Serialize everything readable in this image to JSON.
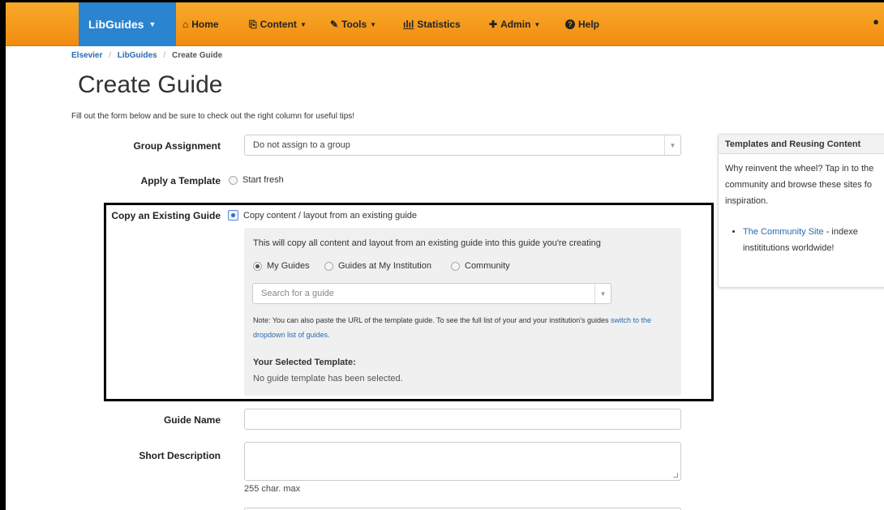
{
  "nav": {
    "brand": "LibGuides",
    "items": [
      {
        "label": "Home",
        "icon": "home-icon",
        "glyph": "🏠"
      },
      {
        "label": "Content",
        "icon": "content-icon",
        "glyph": "⎘"
      },
      {
        "label": "Tools",
        "icon": "wrench-icon",
        "glyph": "🔧"
      },
      {
        "label": "Statistics",
        "icon": "bar-chart-icon",
        "glyph": "▥"
      },
      {
        "label": "Admin",
        "icon": "puzzle-icon",
        "glyph": "⧉"
      },
      {
        "label": "Help",
        "icon": "help-icon",
        "glyph": "?"
      }
    ]
  },
  "breadcrumb": [
    "Elsevier",
    "LibGuides",
    "Create Guide"
  ],
  "page": {
    "title": "Create Guide",
    "intro": "Fill out the form below and be sure to check out the right column for useful tips!"
  },
  "form": {
    "group_label": "Group Assignment",
    "group_value": "Do not assign to a group",
    "template_label": "Apply a Template",
    "template_option": "Start fresh",
    "copy_label": "Copy an Existing Guide",
    "copy_option": "Copy content / layout from an existing guide",
    "copy_desc": "This will copy all content and layout from an existing guide into this guide you're creating",
    "scope_options": [
      "My Guides",
      "Guides at My Institution",
      "Community"
    ],
    "search_placeholder": "Search for a guide",
    "note_text": "Note: You can also paste the URL of the template guide. To see the full list of your and your institution's guides",
    "note_link": "switch to the dropdown list of guides.",
    "selected_title": "Your Selected Template:",
    "selected_none": "No guide template has been selected.",
    "name_label": "Guide Name",
    "desc_label": "Short Description",
    "desc_help": "255 char. max"
  },
  "sidebar": {
    "title": "Templates and Reusing Content",
    "body_lines": [
      "Why reinvent the wheel? Tap in to the",
      "community and browse these sites fo",
      "inspiration."
    ],
    "link_text": "The Community Site",
    "link_suffix": " - indexe",
    "link_line2": "instititutions worldwide!"
  },
  "colors": {
    "navbar": "#f39a1a",
    "brand": "#2a84d0",
    "link": "#2a6ab3"
  }
}
